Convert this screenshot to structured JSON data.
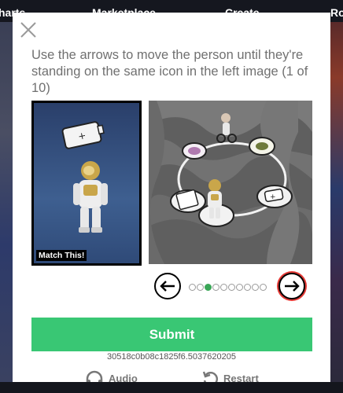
{
  "background": {
    "nav_items": [
      "harts",
      "Marketplace",
      "Create",
      "Ro"
    ]
  },
  "modal": {
    "instructions": "Use the arrows to move the person until they're standing on the same icon in the left image (1 of 10)",
    "match_label": "Match This!",
    "pager": {
      "total": 10,
      "current": 3
    },
    "submit_label": "Submit",
    "session_id": "30518c0b08c1825f6.5037620205",
    "audio_label": "Audio",
    "restart_label": "Restart",
    "colors": {
      "submit": "#39c774",
      "active_dot": "#3aa657",
      "right_arrow_ring": "#e53935"
    },
    "icons": {
      "close": "close-icon",
      "left": "arrow-left-icon",
      "right": "arrow-right-icon",
      "audio": "headphones-icon",
      "restart": "restart-icon"
    }
  }
}
